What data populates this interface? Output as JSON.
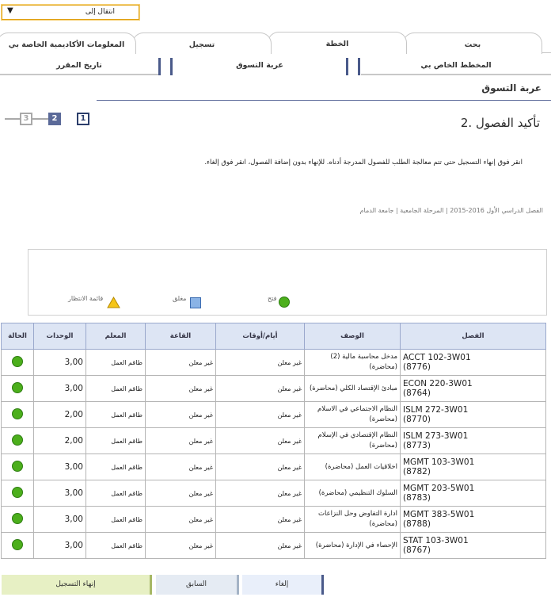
{
  "jump": {
    "label": "انتقال إلى",
    "arrow": "▼"
  },
  "tabs": [
    {
      "label": "بحث"
    },
    {
      "label": "الخطة"
    },
    {
      "label": "تسجيل"
    },
    {
      "label": "المعلومات الأكاديمية الخاصة بي"
    }
  ],
  "subtabs": [
    {
      "label": "المخطط الخاص بي"
    },
    {
      "label": "عربة التسوق"
    },
    {
      "label": "تاريخ المقرر"
    }
  ],
  "page_title": "عربة التسوق",
  "steps": [
    "1",
    "2",
    "3"
  ],
  "step_heading": "2. تأكيد الفصول",
  "instruction": "انقر فوق إنهاء التسجيل حتى تتم معالجة الطلب للفصول المدرجة أدناه. للإنهاء بدون إضافة الفصول، انقر فوق إلغاء.",
  "term_line": "الفصل الدراسي الأول 2016-2015 | المرحلة الجامعية | جامعة الدمام",
  "legend": {
    "open": "فتح",
    "closed": "مغلق",
    "waitlist": "قائمة الانتظار"
  },
  "table": {
    "headers": {
      "class": "الفصل",
      "description": "الوصف",
      "days_times": "أيام/أوقات",
      "room": "القاعة",
      "instructor": "المعلم",
      "units": "الوحدات",
      "status": "الحالة"
    },
    "rows": [
      {
        "class": "ACCT 102-3W01",
        "id": "(8776)",
        "desc": "مدخل محاسبة مالية (2) (محاضرة)",
        "days": "غير معلن",
        "room": "غير معلن",
        "instructor": "طاقم العمل",
        "units": "3,00",
        "status": "open"
      },
      {
        "class": "ECON 220-3W01",
        "id": "(8764)",
        "desc": "مبادئ الإقتصاد الكلي (محاضرة)",
        "days": "غير معلن",
        "room": "غير معلن",
        "instructor": "طاقم العمل",
        "units": "3,00",
        "status": "open"
      },
      {
        "class": "ISLM 272-3W01",
        "id": "(8770)",
        "desc": "النظام الاجتماعي في الاسلام (محاضرة)",
        "days": "غير معلن",
        "room": "غير معلن",
        "instructor": "طاقم العمل",
        "units": "2,00",
        "status": "open"
      },
      {
        "class": "ISLM 273-3W01",
        "id": "(8773)",
        "desc": "النظام الإقتصادي في الإسلام (محاضرة)",
        "days": "غير معلن",
        "room": "غير معلن",
        "instructor": "طاقم العمل",
        "units": "2,00",
        "status": "open"
      },
      {
        "class": "MGMT 103-3W01",
        "id": "(8782)",
        "desc": "اخلاقيات العمل (محاضرة)",
        "days": "غير معلن",
        "room": "غير معلن",
        "instructor": "طاقم العمل",
        "units": "3,00",
        "status": "open"
      },
      {
        "class": "MGMT 203-5W01",
        "id": "(8783)",
        "desc": "السلوك التنظيمي (محاضرة)",
        "days": "غير معلن",
        "room": "غير معلن",
        "instructor": "طاقم العمل",
        "units": "3,00",
        "status": "open"
      },
      {
        "class": "MGMT 383-5W01",
        "id": "(8788)",
        "desc": "ادارة التفاوض وحل النزاعات (محاضرة)",
        "days": "غير معلن",
        "room": "غير معلن",
        "instructor": "طاقم العمل",
        "units": "3,00",
        "status": "open"
      },
      {
        "class": "STAT 103-3W01",
        "id": "(8767)",
        "desc": "الإحصاء في الإدارة (محاضرة)",
        "days": "غير معلن",
        "room": "غير معلن",
        "instructor": "طاقم العمل",
        "units": "3,00",
        "status": "open"
      }
    ]
  },
  "buttons": {
    "finish": "إنهاء التسجيل",
    "previous": "السابق",
    "cancel": "إلغاء"
  },
  "colors": {
    "open": "#4caf1c",
    "closed": "#8ab3e6",
    "waitlist": "#f5c518",
    "accent": "#5b6a99"
  }
}
